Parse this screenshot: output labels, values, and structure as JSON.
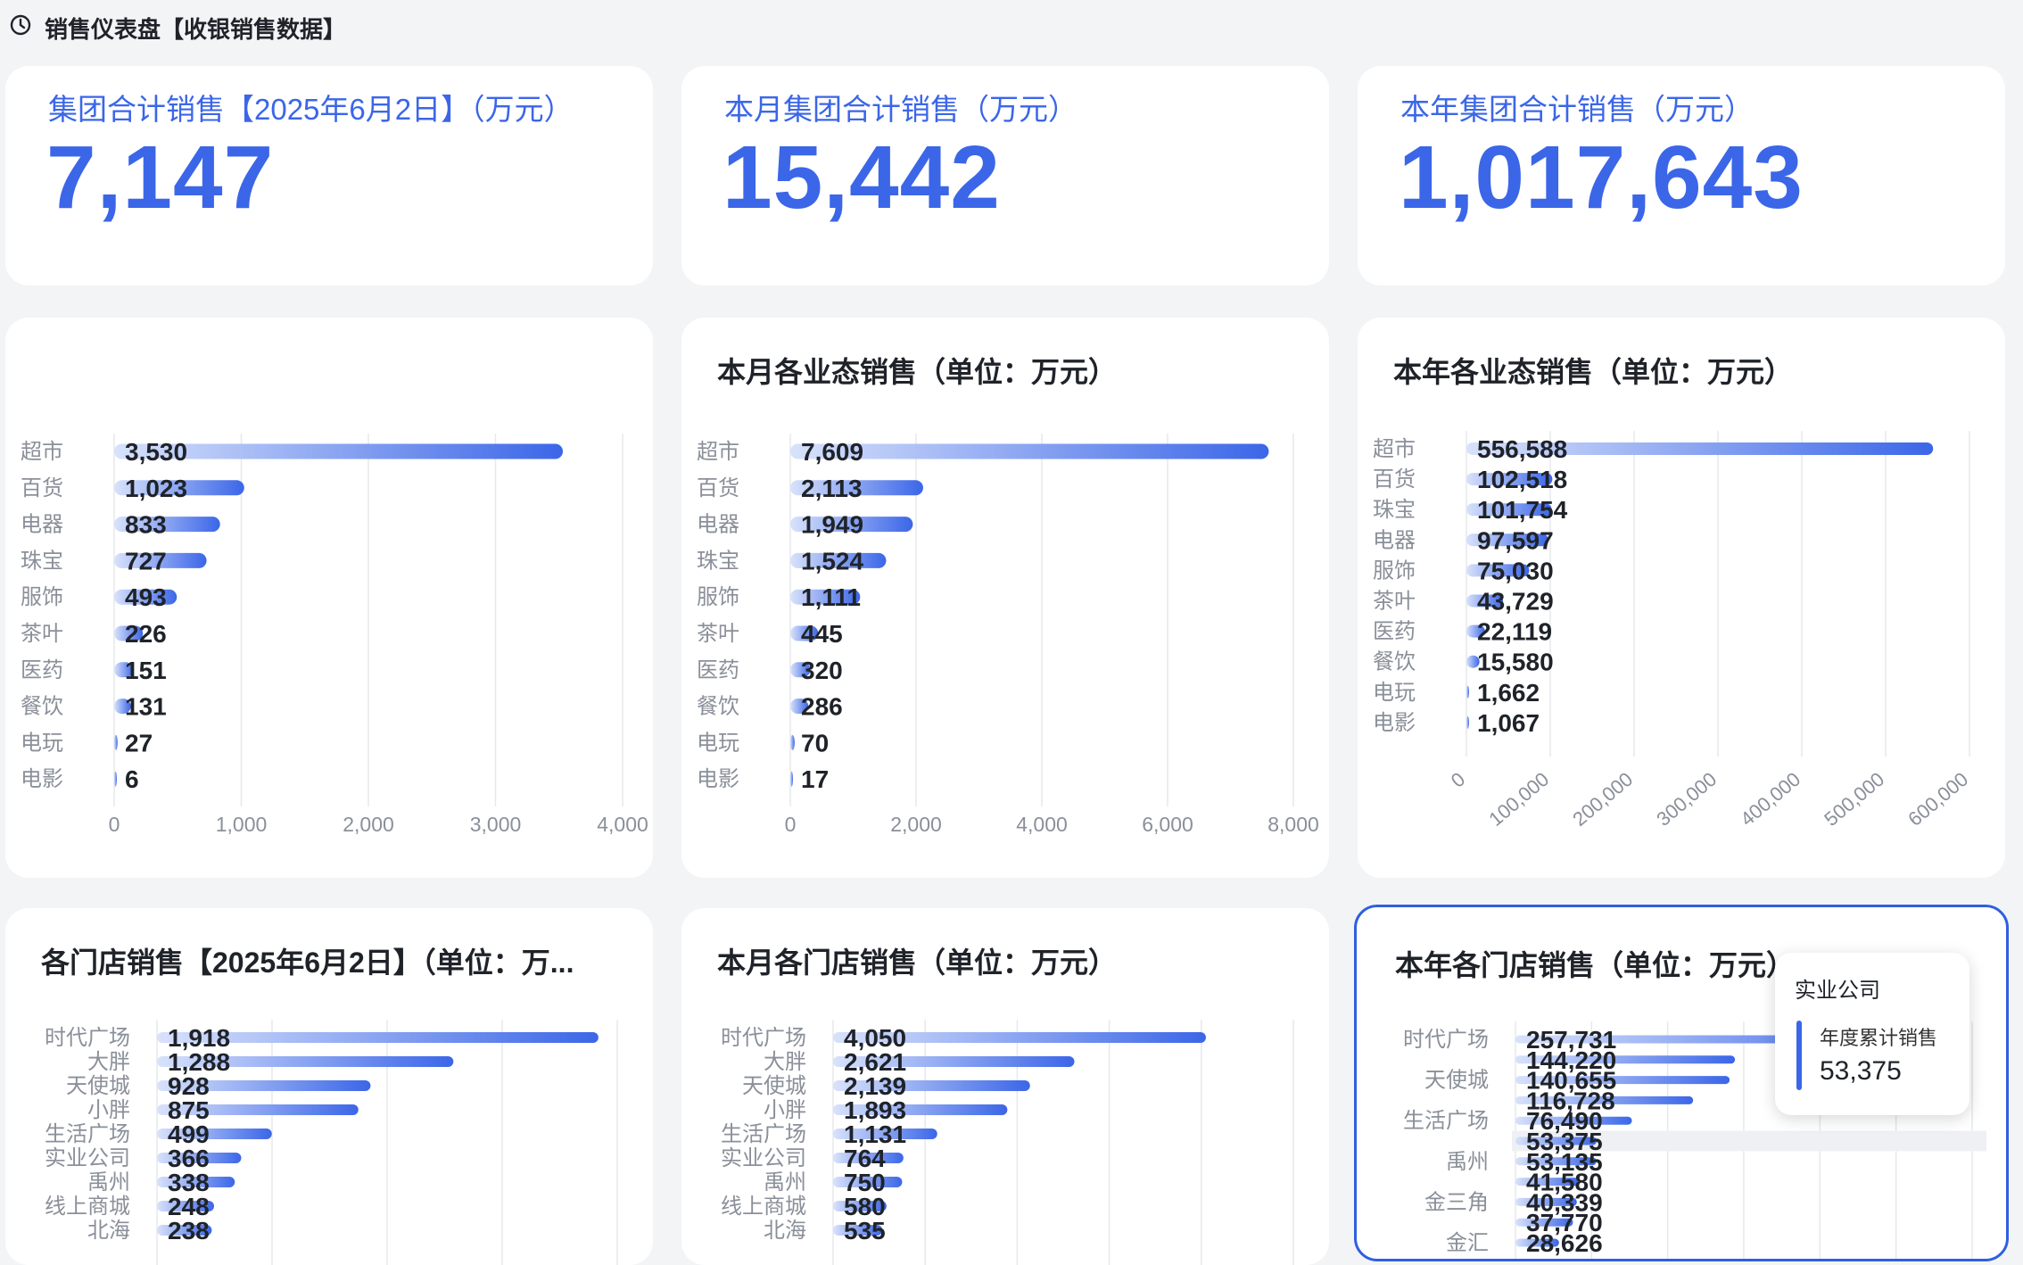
{
  "header": {
    "title": "销售仪表盘【收银销售数据】",
    "icon": "clock-icon"
  },
  "kpis": [
    {
      "label": "集团合计销售【2025年6月2日】（万元）",
      "value": "7,147"
    },
    {
      "label": "本月集团合计销售（万元）",
      "value": "15,442"
    },
    {
      "label": "本年集团合计销售（万元）",
      "value": "1,017,643"
    }
  ],
  "colors": {
    "accent": "#3b66e8",
    "bar_start": "#d8e2fb",
    "bar_end": "#3b66e8",
    "selected_border": "#2f5fe0"
  },
  "chart_data": [
    {
      "type": "bar",
      "orientation": "horizontal",
      "title": "",
      "categories": [
        "超市",
        "百货",
        "电器",
        "珠宝",
        "服饰",
        "茶叶",
        "医药",
        "餐饮",
        "电玩",
        "电影"
      ],
      "values": [
        3530,
        1023,
        833,
        727,
        493,
        226,
        151,
        131,
        27,
        6
      ],
      "value_labels": [
        "3,530",
        "1,023",
        "833",
        "727",
        "493",
        "226",
        "151",
        "131",
        "27",
        "6"
      ],
      "xlim": [
        0,
        4000
      ],
      "ticks": [
        "0",
        "1,000",
        "2,000",
        "3,000",
        "4,000"
      ],
      "tick_values": [
        0,
        1000,
        2000,
        3000,
        4000
      ],
      "grid": true
    },
    {
      "type": "bar",
      "orientation": "horizontal",
      "title": "本月各业态销售（单位：万元）",
      "categories": [
        "超市",
        "百货",
        "电器",
        "珠宝",
        "服饰",
        "茶叶",
        "医药",
        "餐饮",
        "电玩",
        "电影"
      ],
      "values": [
        7609,
        2113,
        1949,
        1524,
        1111,
        445,
        320,
        286,
        70,
        17
      ],
      "value_labels": [
        "7,609",
        "2,113",
        "1,949",
        "1,524",
        "1,111",
        "445",
        "320",
        "286",
        "70",
        "17"
      ],
      "xlim": [
        0,
        8000
      ],
      "ticks": [
        "0",
        "2,000",
        "4,000",
        "6,000",
        "8,000"
      ],
      "tick_values": [
        0,
        2000,
        4000,
        6000,
        8000
      ],
      "grid": true
    },
    {
      "type": "bar",
      "orientation": "horizontal",
      "title": "本年各业态销售（单位：万元）",
      "categories": [
        "超市",
        "百货",
        "珠宝",
        "电器",
        "服饰",
        "茶叶",
        "医药",
        "餐饮",
        "电玩",
        "电影"
      ],
      "values": [
        556588,
        102518,
        101754,
        97597,
        75030,
        43729,
        22119,
        15580,
        1662,
        1067
      ],
      "value_labels": [
        "556,588",
        "102,518",
        "101,754",
        "97,597",
        "75,030",
        "43,729",
        "22,119",
        "15,580",
        "1,662",
        "1,067"
      ],
      "xlim": [
        0,
        600000
      ],
      "ticks": [
        "0",
        "100,000",
        "200,000",
        "300,000",
        "400,000",
        "500,000",
        "600,000"
      ],
      "tick_values": [
        0,
        100000,
        200000,
        300000,
        400000,
        500000,
        600000
      ],
      "grid": true,
      "tick_rotation": "rotated"
    },
    {
      "type": "bar",
      "orientation": "horizontal",
      "title": "各门店销售【2025年6月2日】（单位：万...",
      "categories": [
        "时代广场",
        "大胖",
        "天使城",
        "小胖",
        "生活广场",
        "实业公司",
        "禹州",
        "线上商城",
        "北海"
      ],
      "values": [
        1918,
        1288,
        928,
        875,
        499,
        366,
        338,
        248,
        238
      ],
      "value_labels": [
        "1,918",
        "1,288",
        "928",
        "875",
        "499",
        "366",
        "338",
        "248",
        "238"
      ],
      "xlim": [
        0,
        2000
      ],
      "tick_values": [
        0,
        500,
        1000,
        1500,
        2000
      ],
      "grid": true
    },
    {
      "type": "bar",
      "orientation": "horizontal",
      "title": "本月各门店销售（单位：万元）",
      "categories": [
        "时代广场",
        "大胖",
        "天使城",
        "小胖",
        "生活广场",
        "实业公司",
        "禹州",
        "线上商城",
        "北海"
      ],
      "values": [
        4050,
        2621,
        2139,
        1893,
        1131,
        764,
        750,
        580,
        535
      ],
      "value_labels": [
        "4,050",
        "2,621",
        "2,139",
        "1,893",
        "1,131",
        "764",
        "750",
        "580",
        "535"
      ],
      "xlim": [
        0,
        5000
      ],
      "tick_values": [
        0,
        1000,
        2000,
        3000,
        4000,
        5000
      ],
      "grid": true
    },
    {
      "type": "bar",
      "orientation": "horizontal",
      "title": "本年各门店销售（单位：万元）",
      "categories": [
        "时代广场",
        "",
        "天使城",
        "",
        "生活广场",
        "",
        "禹州",
        "",
        "金三角",
        "",
        "金汇"
      ],
      "values": [
        257731,
        144220,
        140655,
        116728,
        76490,
        53375,
        53135,
        41580,
        40339,
        37770,
        28626
      ],
      "value_labels": [
        "257,731",
        "144,220",
        "140,655",
        "116,728",
        "76,490",
        "53,375",
        "53,135",
        "41,580",
        "40,339",
        "37,770",
        "28,626"
      ],
      "xlim": [
        0,
        300000
      ],
      "tick_values": [
        0,
        50000,
        100000,
        150000,
        200000,
        250000,
        300000
      ],
      "grid": true,
      "tooltip": {
        "name": "实业公司",
        "series": "年度累计销售",
        "value": "53,375"
      }
    }
  ]
}
